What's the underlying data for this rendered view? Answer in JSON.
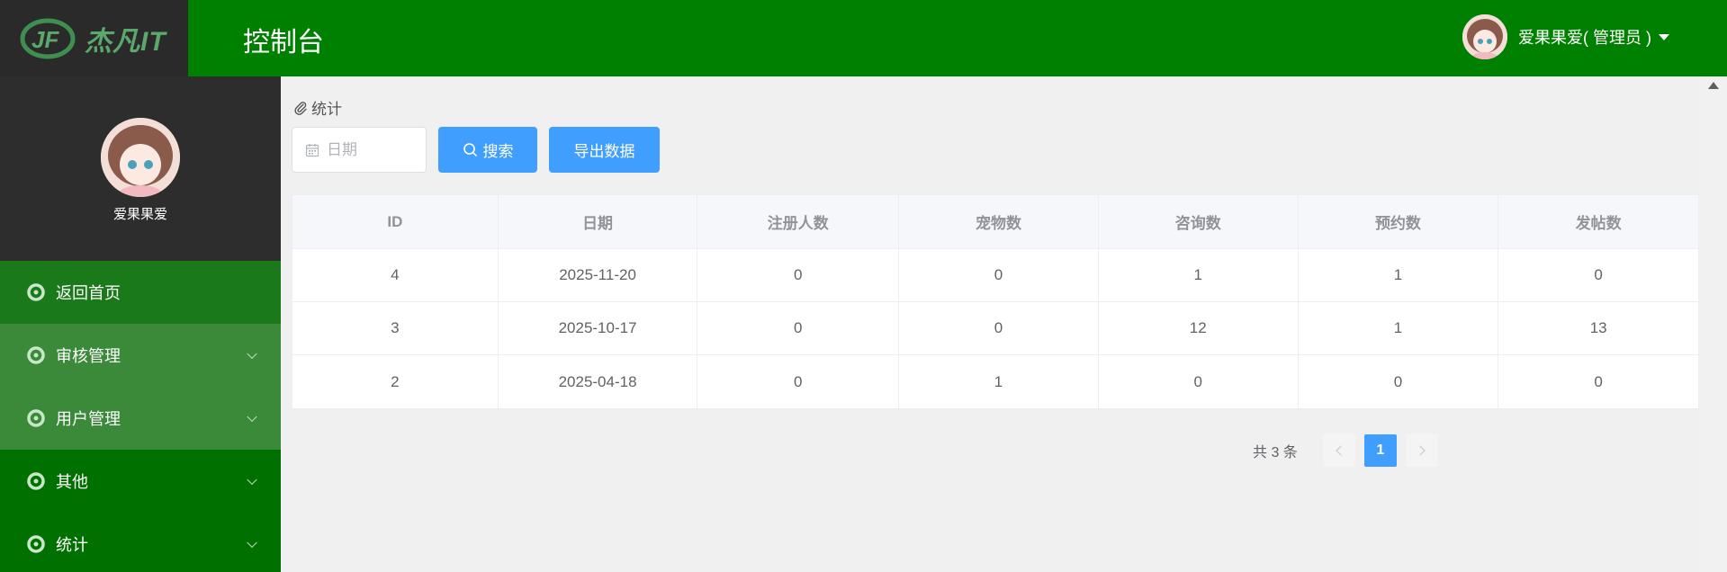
{
  "header": {
    "logo_text": "杰凡IT",
    "title": "控制台",
    "user_label": "爱果果爱( 管理员 )",
    "background": "#008000"
  },
  "sidebar": {
    "profile_name": "爱果果爱",
    "items": [
      {
        "label": "返回首页",
        "expandable": false
      },
      {
        "label": "审核管理",
        "expandable": true
      },
      {
        "label": "用户管理",
        "expandable": true
      },
      {
        "label": "其他",
        "expandable": true
      },
      {
        "label": "统计",
        "expandable": true
      }
    ]
  },
  "main": {
    "breadcrumb": "统计",
    "date_placeholder": "日期",
    "search_label": "搜索",
    "export_label": "导出数据",
    "accent": "#409eff",
    "table": {
      "headers": [
        "ID",
        "日期",
        "注册人数",
        "宠物数",
        "咨询数",
        "预约数",
        "发帖数"
      ],
      "rows": [
        [
          "4",
          "2025-11-20",
          "0",
          "0",
          "1",
          "1",
          "0"
        ],
        [
          "3",
          "2025-10-17",
          "0",
          "0",
          "12",
          "1",
          "13"
        ],
        [
          "2",
          "2025-04-18",
          "0",
          "1",
          "0",
          "0",
          "0"
        ]
      ]
    },
    "pagination": {
      "total": "共 3 条",
      "current_page": "1"
    }
  }
}
